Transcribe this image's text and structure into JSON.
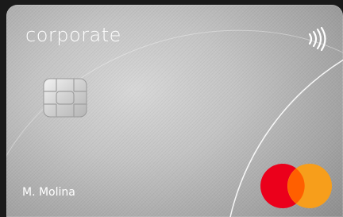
{
  "card": {
    "brand_label": "corporate",
    "holder_name": "M. Molina",
    "network": "mastercard-logo",
    "colors": {
      "body": "#b8b8b8",
      "text": "#ffffff",
      "mc_red": "#eb001b",
      "mc_yellow": "#f79e1b",
      "mc_overlap": "#ff5f00"
    },
    "icons": [
      "contactless-icon",
      "chip-icon",
      "mastercard-logo"
    ]
  }
}
